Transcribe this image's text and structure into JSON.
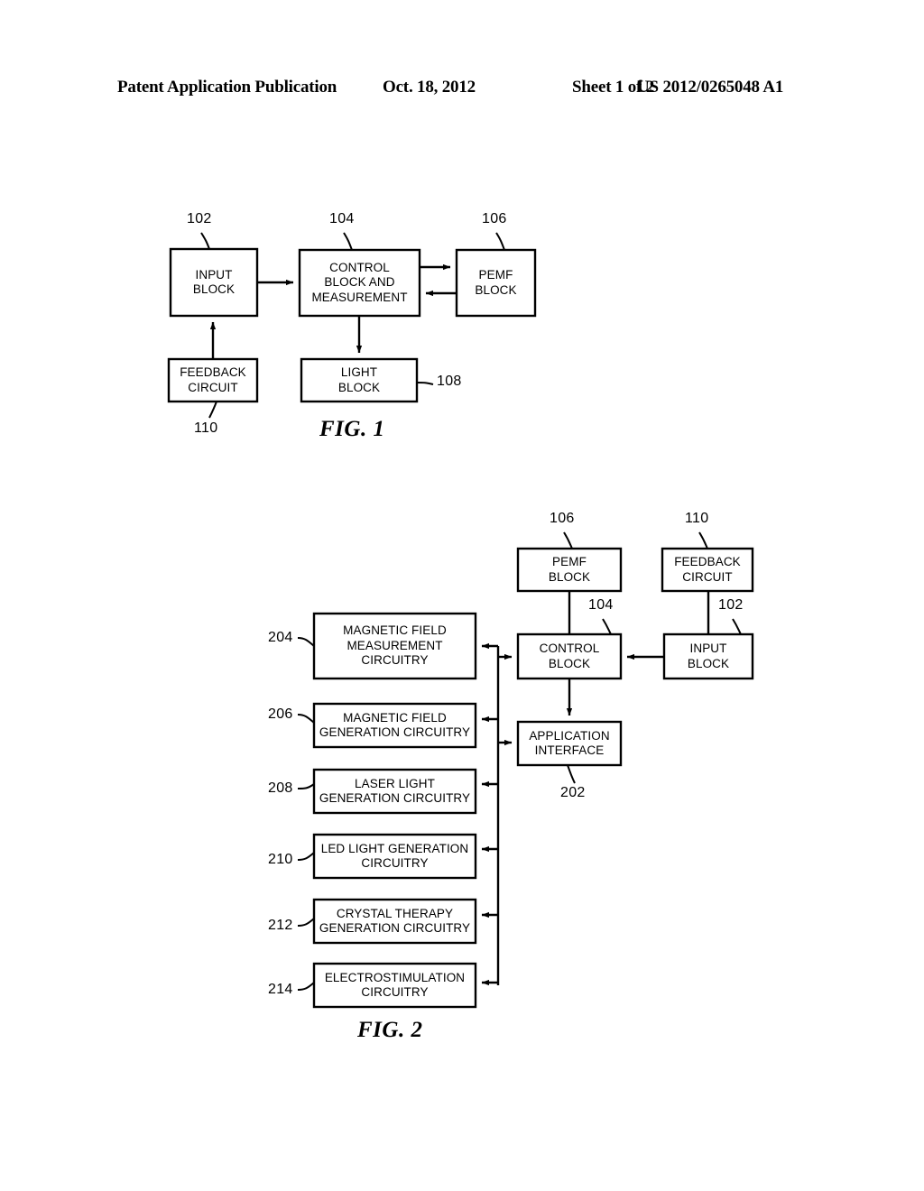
{
  "header": {
    "publication": "Patent Application Publication",
    "date": "Oct. 18, 2012",
    "sheet": "Sheet 1 of 2",
    "number": "US 2012/0265048 A1"
  },
  "figures": [
    {
      "caption": "FIG. 1",
      "blocks": [
        {
          "id": "input-block",
          "ref": "102",
          "lines": [
            "INPUT",
            "BLOCK"
          ]
        },
        {
          "id": "control-block",
          "ref": "104",
          "lines": [
            "CONTROL",
            "BLOCK AND",
            "MEASUREMENT"
          ]
        },
        {
          "id": "pemf-block",
          "ref": "106",
          "lines": [
            "PEMF",
            "BLOCK"
          ]
        },
        {
          "id": "light-block",
          "ref": "108",
          "lines": [
            "LIGHT",
            "BLOCK"
          ]
        },
        {
          "id": "feedback-circuit",
          "ref": "110",
          "lines": [
            "FEEDBACK",
            "CIRCUIT"
          ]
        }
      ]
    },
    {
      "caption": "FIG. 2",
      "blocks": [
        {
          "id": "pemf-block",
          "ref": "106",
          "lines": [
            "PEMF",
            "BLOCK"
          ]
        },
        {
          "id": "feedback-circuit",
          "ref": "110",
          "lines": [
            "FEEDBACK",
            "CIRCUIT"
          ]
        },
        {
          "id": "control-block",
          "ref": "104",
          "lines": [
            "CONTROL",
            "BLOCK"
          ]
        },
        {
          "id": "input-block",
          "ref": "102",
          "lines": [
            "INPUT",
            "BLOCK"
          ]
        },
        {
          "id": "application-interface",
          "ref": "202",
          "lines": [
            "APPLICATION",
            "INTERFACE"
          ]
        },
        {
          "id": "magnetic-field-measurement",
          "ref": "204",
          "lines": [
            "MAGNETIC FIELD",
            "MEASUREMENT",
            "CIRCUITRY"
          ]
        },
        {
          "id": "magnetic-field-generation",
          "ref": "206",
          "lines": [
            "MAGNETIC FIELD",
            "GENERATION CIRCUITRY"
          ]
        },
        {
          "id": "laser-light-generation",
          "ref": "208",
          "lines": [
            "LASER LIGHT",
            "GENERATION CIRCUITRY"
          ]
        },
        {
          "id": "led-light-generation",
          "ref": "210",
          "lines": [
            "LED LIGHT GENERATION",
            "CIRCUITRY"
          ]
        },
        {
          "id": "crystal-therapy-generation",
          "ref": "212",
          "lines": [
            "CRYSTAL THERAPY",
            "GENERATION CIRCUITRY"
          ]
        },
        {
          "id": "electrostimulation",
          "ref": "214",
          "lines": [
            "ELECTROSTIMULATION",
            "CIRCUITRY"
          ]
        }
      ]
    }
  ],
  "colors": {
    "ink": "#000000",
    "paper": "#ffffff"
  }
}
